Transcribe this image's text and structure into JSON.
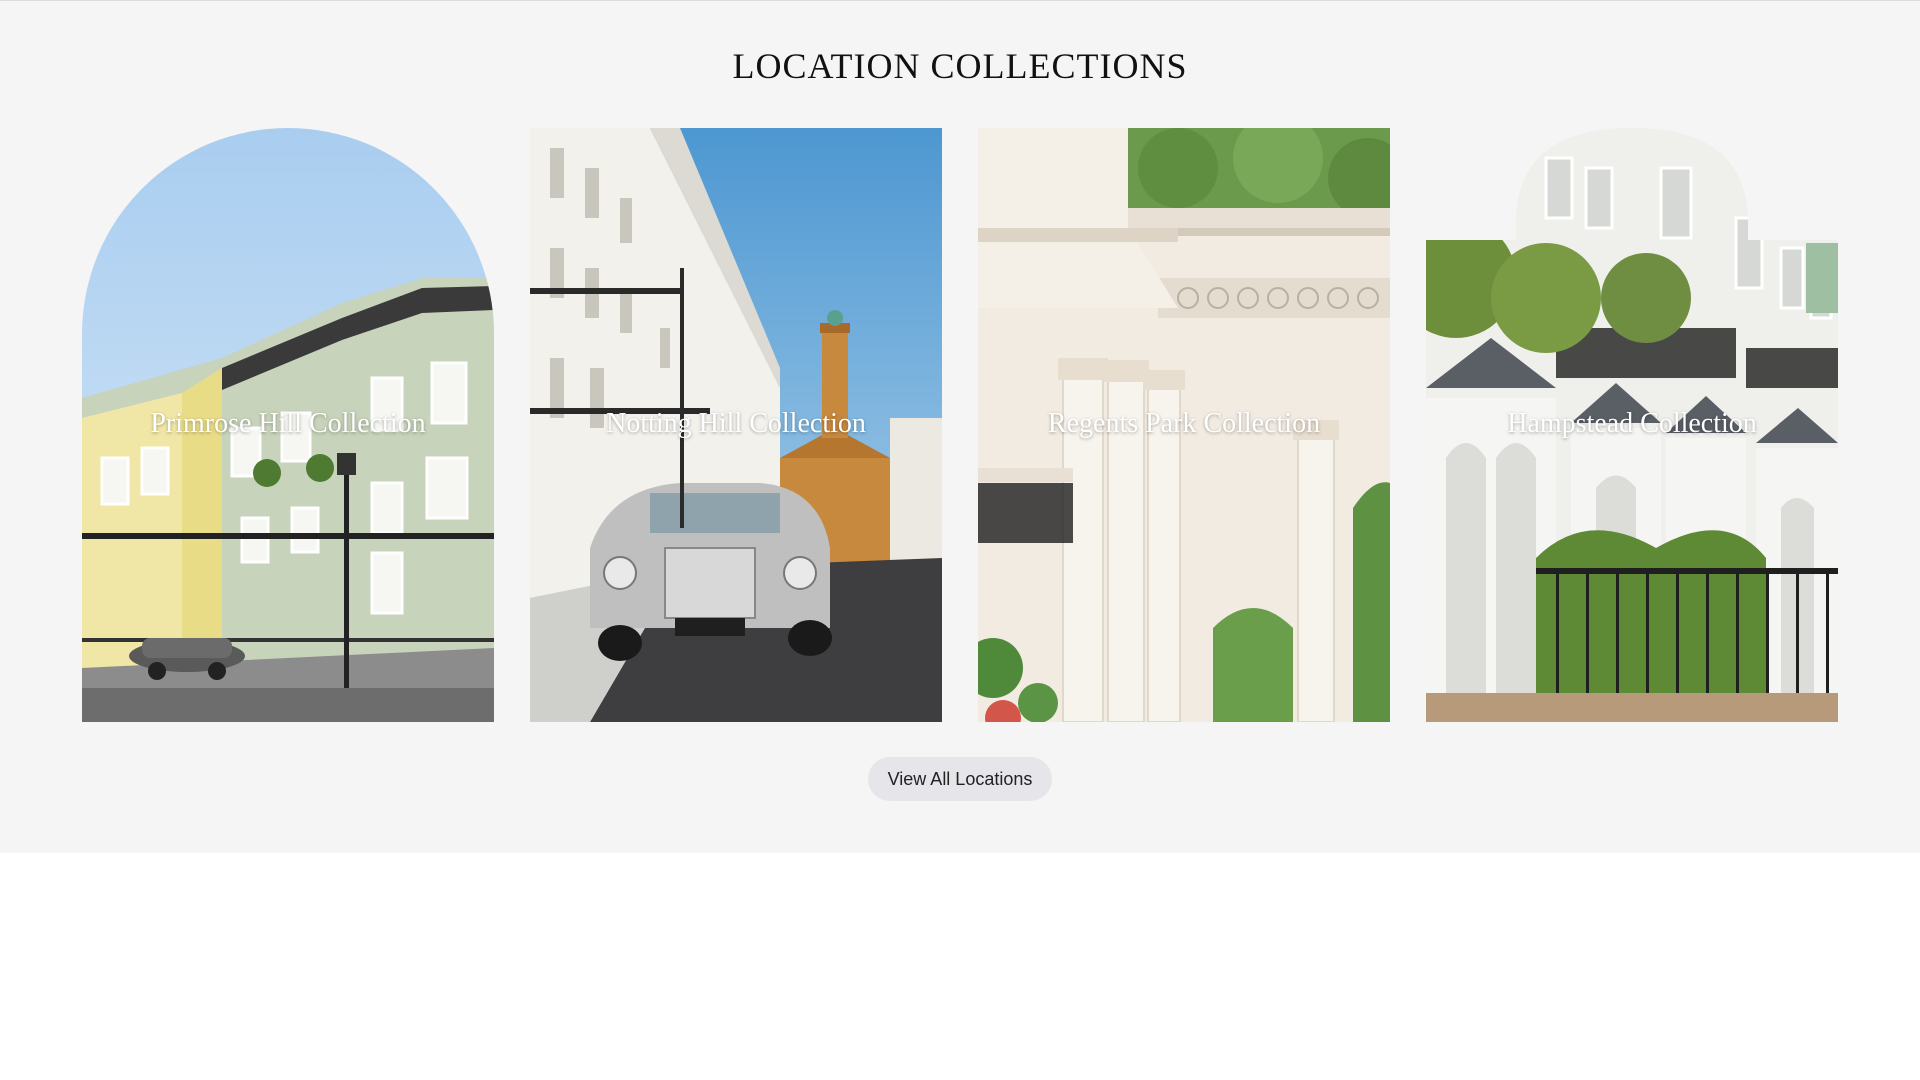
{
  "section": {
    "title": "LOCATION COLLECTIONS",
    "background": "#f5f5f5"
  },
  "collections": [
    {
      "label": "Primrose Hill Collection",
      "shape": "arch"
    },
    {
      "label": "Notting Hill Collection",
      "shape": "rectangle"
    },
    {
      "label": "Regents Park Collection",
      "shape": "rectangle"
    },
    {
      "label": "Hampstead Collection",
      "shape": "stepped-arch"
    }
  ],
  "actions": {
    "view_all_label": "View All Locations"
  }
}
